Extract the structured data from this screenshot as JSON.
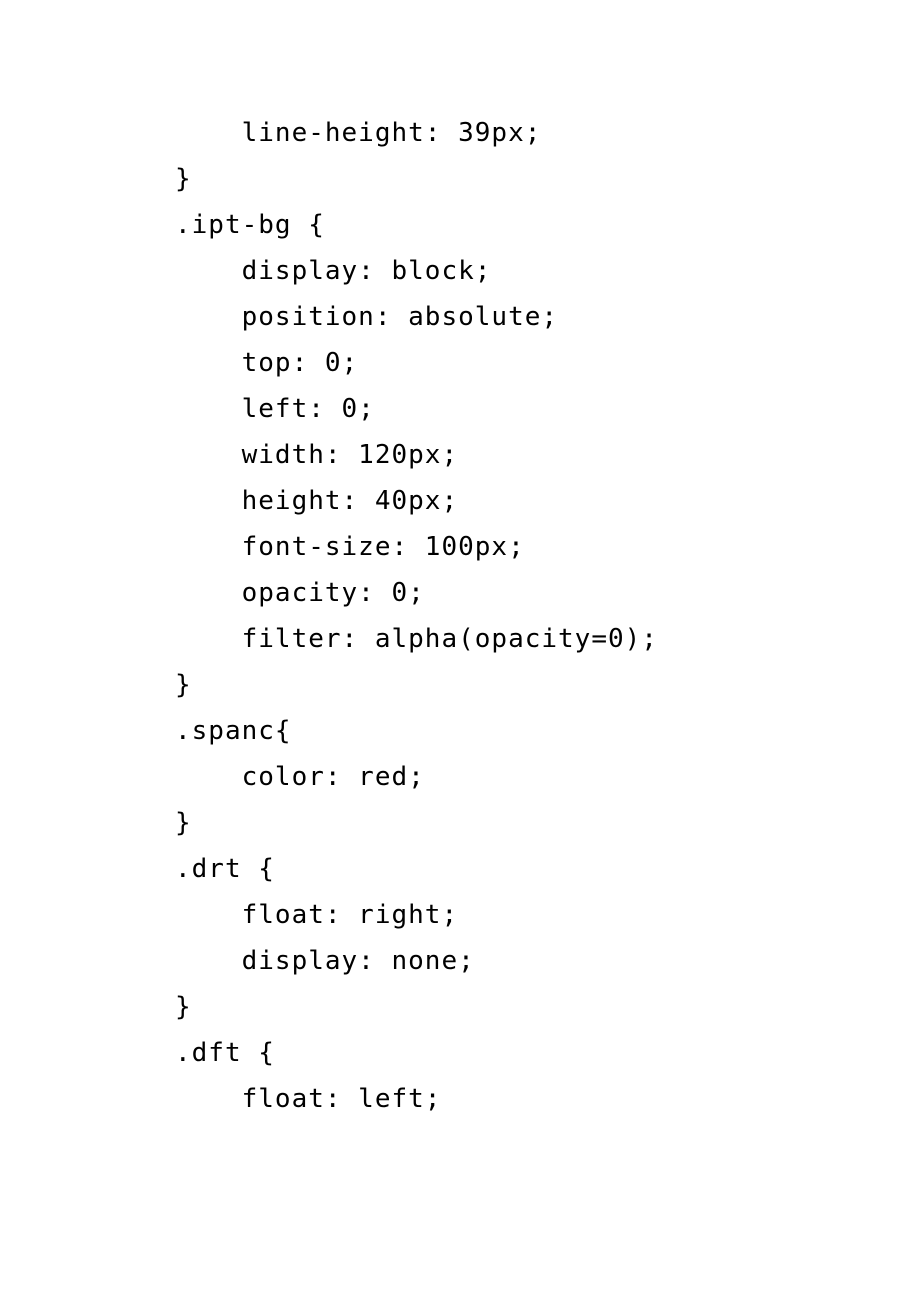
{
  "code": {
    "lines": [
      "    line-height: 39px;",
      "}",
      ".ipt-bg {",
      "    display: block;",
      "    position: absolute;",
      "    top: 0;",
      "    left: 0;",
      "    width: 120px;",
      "    height: 40px;",
      "    font-size: 100px;",
      "    opacity: 0;",
      "    filter: alpha(opacity=0);",
      "}",
      ".spanc{",
      "    color: red;",
      "}",
      ".drt {",
      "    float: right;",
      "    display: none;",
      "}",
      ".dft {",
      "    float: left;"
    ]
  }
}
